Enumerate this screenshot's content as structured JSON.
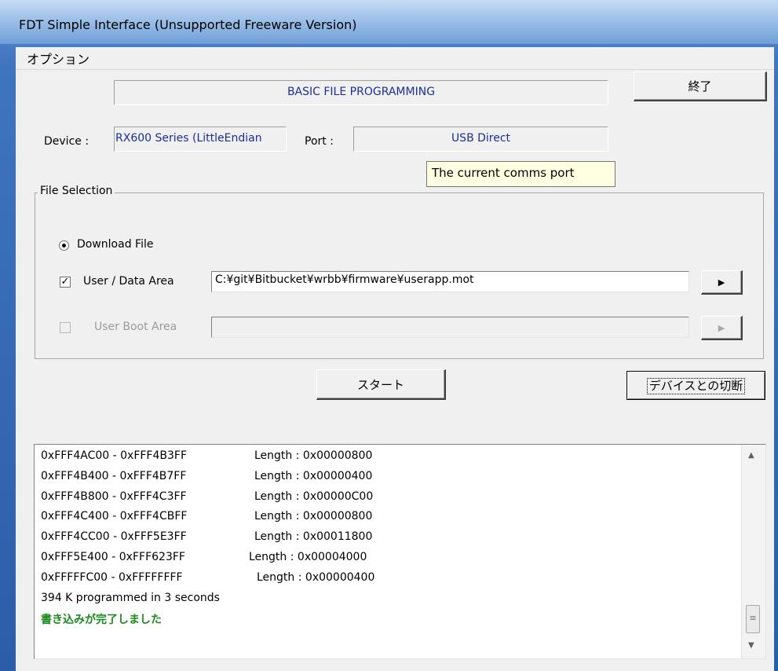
{
  "window": {
    "title": "FDT Simple Interface   (Unsupported Freeware Version)"
  },
  "menu": {
    "options": "オプション"
  },
  "header": {
    "mode": "BASIC FILE PROGRAMMING",
    "exit_label": "終了"
  },
  "device": {
    "label": "Device :",
    "value": "RX600 Series (LittleEndian"
  },
  "port": {
    "label": "Port :",
    "value": "USB Direct",
    "tooltip": "The current comms port"
  },
  "file_selection": {
    "title": "File Selection",
    "download_file_label": "Download File",
    "user_data_label": "User / Data Area",
    "user_data_path": "C:¥git¥Bitbucket¥wrbb¥firmware¥userapp.mot",
    "user_boot_label": "User Boot Area",
    "user_boot_path": ""
  },
  "actions": {
    "start_label": "スタート",
    "disconnect_label": "デバイスとの切断"
  },
  "log": {
    "lines": [
      {
        "range": "0xFFF4AC00 - 0xFFF4B3FF",
        "length": "Length : 0x00000800"
      },
      {
        "range": "0xFFF4B400 - 0xFFF4B7FF",
        "length": "Length : 0x00000400"
      },
      {
        "range": "0xFFF4B800 - 0xFFF4C3FF",
        "length": "Length : 0x00000C00"
      },
      {
        "range": "0xFFF4C400 - 0xFFF4CBFF",
        "length": "Length : 0x00000800"
      },
      {
        "range": "0xFFF4CC00 - 0xFFF5E3FF",
        "length": "Length : 0x00011800"
      },
      {
        "range": "0xFFF5E400 - 0xFFF623FF",
        "length": "Length : 0x00004000"
      },
      {
        "range": "0xFFFFFC00 - 0xFFFFFFFF",
        "length": "Length : 0x00000400"
      }
    ],
    "summary": "394 K programmed in 3 seconds",
    "complete": "書き込みが完了しました"
  },
  "icons": {
    "browse_arrow": "▶",
    "checkmark": "✓",
    "scroll_up": "▲",
    "scroll_down": "▼",
    "thumb_grip": "≡"
  }
}
